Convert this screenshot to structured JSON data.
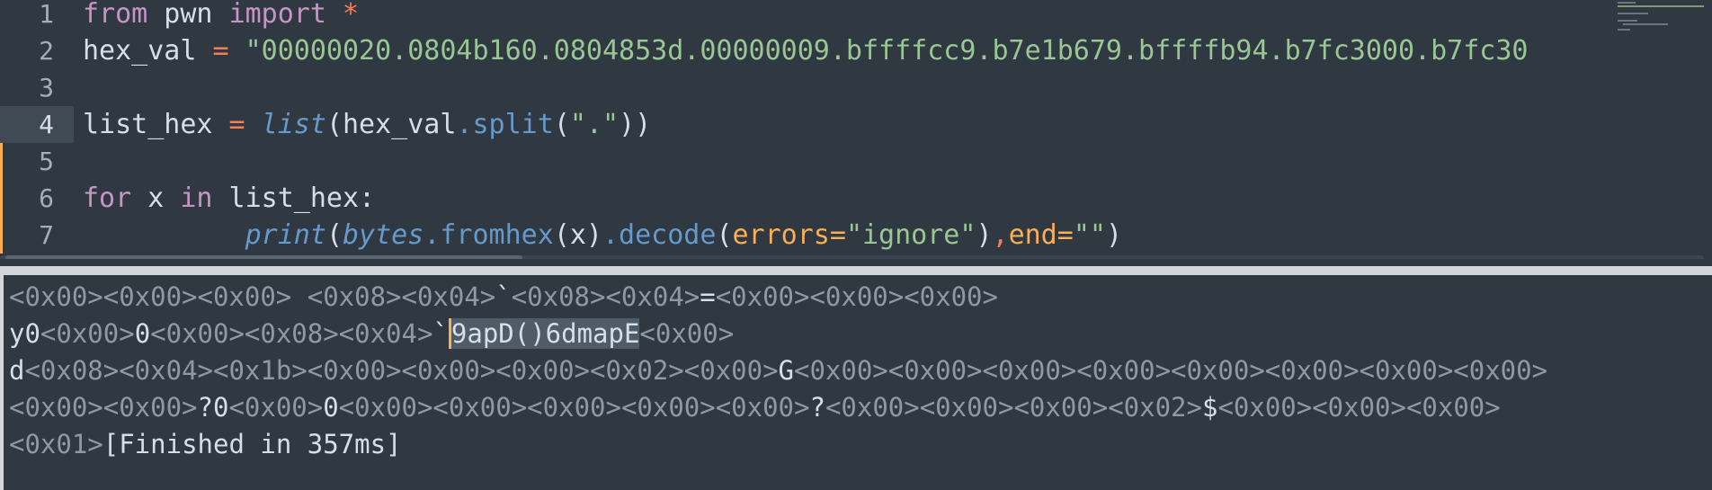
{
  "editor": {
    "lines": [
      {
        "num": "1",
        "tokens": [
          {
            "t": "from",
            "c": "kw"
          },
          {
            "t": " pwn ",
            "c": ""
          },
          {
            "t": "import",
            "c": "kw"
          },
          {
            "t": " ",
            "c": ""
          },
          {
            "t": "*",
            "c": "op"
          }
        ]
      },
      {
        "num": "2",
        "tokens": [
          {
            "t": "hex_val",
            "c": ""
          },
          {
            "t": " = ",
            "c": "op"
          },
          {
            "t": "\"00000020.0804b160.0804853d.00000009.bffffcc9.b7e1b679.bffffb94.b7fc3000.b7fc30",
            "c": "str"
          }
        ]
      },
      {
        "num": "3",
        "tokens": []
      },
      {
        "num": "4",
        "tokens": [
          {
            "t": "list_hex",
            "c": ""
          },
          {
            "t": " = ",
            "c": "op"
          },
          {
            "t": "list",
            "c": "ital"
          },
          {
            "t": "(hex_val",
            "c": ""
          },
          {
            "t": ".split",
            "c": "fn"
          },
          {
            "t": "(",
            "c": ""
          },
          {
            "t": "\".\"",
            "c": "str"
          },
          {
            "t": "))",
            "c": ""
          }
        ]
      },
      {
        "num": "5",
        "tokens": []
      },
      {
        "num": "6",
        "tokens": [
          {
            "t": "for",
            "c": "kw"
          },
          {
            "t": " x ",
            "c": ""
          },
          {
            "t": "in",
            "c": "kw"
          },
          {
            "t": " list_hex:",
            "c": ""
          }
        ]
      },
      {
        "num": "7",
        "tokens": [
          {
            "t": "          ",
            "c": ""
          },
          {
            "t": "print",
            "c": "ital"
          },
          {
            "t": "(",
            "c": ""
          },
          {
            "t": "bytes",
            "c": "ital"
          },
          {
            "t": ".fromhex",
            "c": "fn"
          },
          {
            "t": "(x)",
            "c": ""
          },
          {
            "t": ".decode",
            "c": "fn"
          },
          {
            "t": "(",
            "c": ""
          },
          {
            "t": "errors=",
            "c": "arg"
          },
          {
            "t": "\"ignore\"",
            "c": "str"
          },
          {
            "t": ")",
            "c": ""
          },
          {
            "t": ",",
            "c": "op"
          },
          {
            "t": "end=",
            "c": "arg"
          },
          {
            "t": "\"\"",
            "c": "str"
          },
          {
            "t": ")",
            "c": ""
          }
        ]
      }
    ]
  },
  "output": {
    "lines": [
      [
        {
          "t": "<0x00><0x00><0x00> <0x08><0x04>",
          "c": "nul"
        },
        {
          "t": "`",
          "c": ""
        },
        {
          "t": "<0x08><0x04>",
          "c": "nul"
        },
        {
          "t": "=",
          "c": ""
        },
        {
          "t": "<0x00><0x00><0x00>",
          "c": "nul"
        }
      ],
      [
        {
          "t": "y0",
          "c": ""
        },
        {
          "t": "<0x00>",
          "c": "nul"
        },
        {
          "t": "0",
          "c": ""
        },
        {
          "t": "<0x00><0x08><0x04>",
          "c": "nul"
        },
        {
          "t": "`",
          "c": ""
        },
        {
          "t": "9apD()6dmapE",
          "c": "sel"
        },
        {
          "t": "<0x00>",
          "c": "nul"
        }
      ],
      [
        {
          "t": "d",
          "c": ""
        },
        {
          "t": "<0x08><0x04><0x1b><0x00><0x00><0x00><0x02><0x00>",
          "c": "nul"
        },
        {
          "t": "G",
          "c": ""
        },
        {
          "t": "<0x00><0x00><0x00><0x00><0x00><0x00><0x00><0x00>",
          "c": "nul"
        }
      ],
      [
        {
          "t": "<0x00><0x00>",
          "c": "nul"
        },
        {
          "t": "?0",
          "c": ""
        },
        {
          "t": "<0x00>",
          "c": "nul"
        },
        {
          "t": "0",
          "c": ""
        },
        {
          "t": "<0x00><0x00><0x00><0x00><0x00>",
          "c": "nul"
        },
        {
          "t": "?",
          "c": ""
        },
        {
          "t": "<0x00><0x00><0x00><0x02>",
          "c": "nul"
        },
        {
          "t": "$",
          "c": ""
        },
        {
          "t": "<0x00><0x00><0x00>",
          "c": "nul"
        }
      ],
      [
        {
          "t": "<0x01>",
          "c": "nul"
        },
        {
          "t": "[Finished in 357ms]",
          "c": ""
        }
      ]
    ]
  },
  "colors": {
    "background": "#303841",
    "keyword": "#c695c6",
    "operator": "#f97b58",
    "string": "#99c794",
    "function": "#6699cc",
    "argument": "#f9ae58",
    "null_byte": "#8f98a3"
  }
}
